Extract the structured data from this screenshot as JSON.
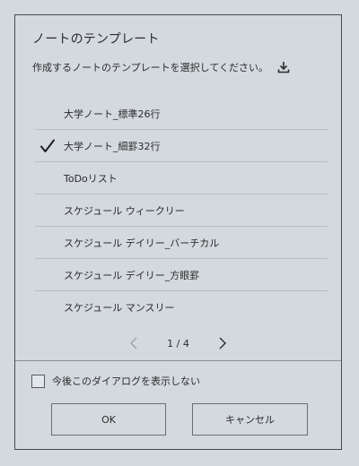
{
  "dialog": {
    "title": "ノートのテンプレート",
    "instruction": "作成するノートのテンプレートを選択してください。",
    "download_icon": "download-icon"
  },
  "templates": [
    {
      "label": "大学ノート_標準26行",
      "selected": false
    },
    {
      "label": "大学ノート_細罫32行",
      "selected": true
    },
    {
      "label": "ToDoリスト",
      "selected": false
    },
    {
      "label": "スケジュール ウィークリー",
      "selected": false
    },
    {
      "label": "スケジュール デイリー_バーチカル",
      "selected": false
    },
    {
      "label": "スケジュール デイリー_方眼罫",
      "selected": false
    },
    {
      "label": "スケジュール マンスリー",
      "selected": false
    }
  ],
  "pager": {
    "text": "1 / 4",
    "prev_icon": "chevron-left-icon",
    "next_icon": "chevron-right-icon"
  },
  "dont_show": {
    "label": "今後このダイアログを表示しない",
    "checked": false
  },
  "buttons": {
    "ok": "OK",
    "cancel": "キャンセル"
  },
  "colors": {
    "background": "#d3d9de",
    "border": "#4a4a4a",
    "text": "#2b2b2b",
    "disabled": "#9aa0a5"
  }
}
